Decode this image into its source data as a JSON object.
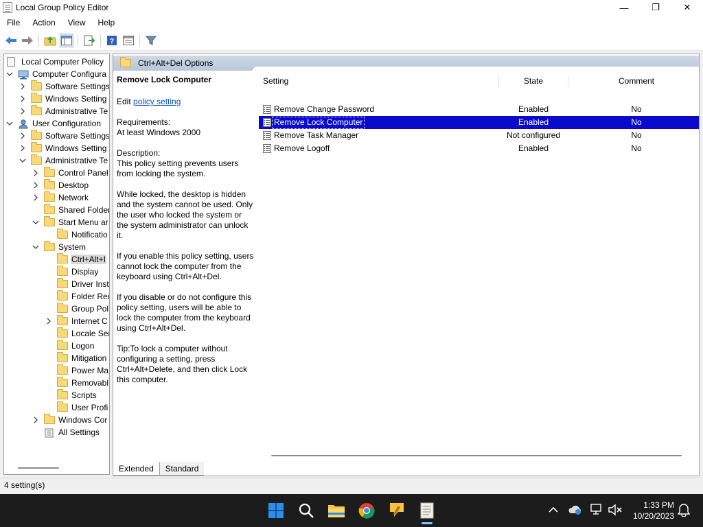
{
  "window": {
    "title": "Local Group Policy Editor",
    "controls": {
      "minimize": "—",
      "maximize": "❐",
      "close": "✕"
    }
  },
  "menu": [
    "File",
    "Action",
    "View",
    "Help"
  ],
  "toolbar": [
    "back-icon",
    "forward-icon",
    "up-folder-icon",
    "show-hide-tree-icon",
    "export-list-icon",
    "help-icon",
    "properties-icon",
    "filter-icon"
  ],
  "tree": {
    "root": "Local Computer Policy",
    "items": [
      {
        "label": "Computer Configura"
      },
      {
        "label": "Software Settings"
      },
      {
        "label": "Windows Setting"
      },
      {
        "label": "Administrative Te"
      },
      {
        "label": "User Configuration"
      },
      {
        "label": "Software Settings"
      },
      {
        "label": "Windows Setting"
      },
      {
        "label": "Administrative Te"
      },
      {
        "label": "Control Panel"
      },
      {
        "label": "Desktop"
      },
      {
        "label": "Network"
      },
      {
        "label": "Shared Folder"
      },
      {
        "label": "Start Menu ar"
      },
      {
        "label": "Notificatio"
      },
      {
        "label": "System"
      },
      {
        "label": "Ctrl+Alt+I"
      },
      {
        "label": "Display"
      },
      {
        "label": "Driver Inst"
      },
      {
        "label": "Folder Red"
      },
      {
        "label": "Group Pol"
      },
      {
        "label": "Internet C"
      },
      {
        "label": "Locale Ser"
      },
      {
        "label": "Logon"
      },
      {
        "label": "Mitigation"
      },
      {
        "label": "Power Ma"
      },
      {
        "label": "Removabl"
      },
      {
        "label": "Scripts"
      },
      {
        "label": "User Profi"
      },
      {
        "label": "Windows Cor"
      },
      {
        "label": "All Settings"
      }
    ]
  },
  "crumb": "Ctrl+Alt+Del Options",
  "description": {
    "title": "Remove Lock Computer",
    "edit_prefix": "Edit ",
    "edit_link": "policy setting ",
    "requirements_label": "Requirements:",
    "requirements_value": "At least Windows 2000",
    "description_label": "Description:",
    "p1": "This policy setting prevents users from locking the system.",
    "p2": "While locked, the desktop is hidden and the system cannot be used. Only the user who locked the system or the system administrator can unlock it.",
    "p3": "If you enable this policy setting, users cannot lock the computer from the keyboard using Ctrl+Alt+Del.",
    "p4": "If you disable or do not configure this policy setting, users will be able to lock the computer from the keyboard using Ctrl+Alt+Del.",
    "p5": "Tip:To lock a computer without configuring a setting, press Ctrl+Alt+Delete, and then click Lock this computer."
  },
  "list": {
    "columns": {
      "setting": "Setting",
      "state": "State",
      "comment": "Comment"
    },
    "rows": [
      {
        "setting": "Remove Change Password",
        "state": "Enabled",
        "comment": "No"
      },
      {
        "setting": "Remove Lock Computer",
        "state": "Enabled",
        "comment": "No"
      },
      {
        "setting": "Remove Task Manager",
        "state": "Not configured",
        "comment": "No"
      },
      {
        "setting": "Remove Logoff",
        "state": "Enabled",
        "comment": "No"
      }
    ]
  },
  "tabs": [
    "Extended",
    "Standard"
  ],
  "status": "4 setting(s)",
  "taskbar": {
    "time": "1:33 PM",
    "date": "10/20/2023"
  },
  "colors": {
    "selection": "#0a0acc",
    "link": "#0b50c8",
    "folder": "#f7d97a",
    "taskbar": "#1c1c1c"
  }
}
